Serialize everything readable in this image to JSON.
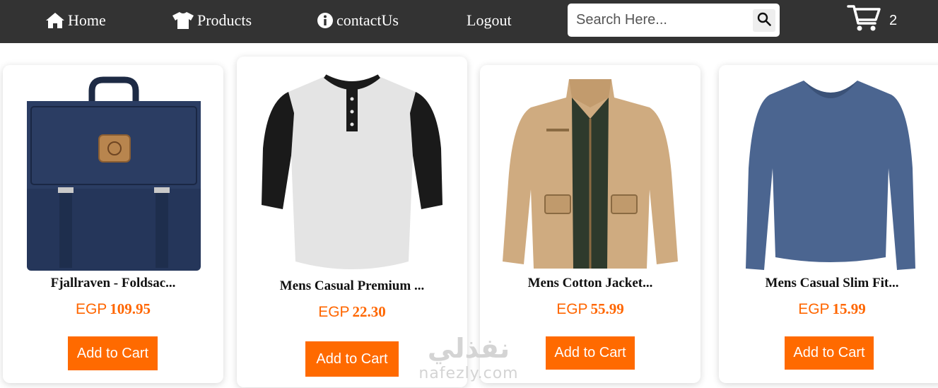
{
  "nav": {
    "home_label": "Home",
    "products_label": "Products",
    "contact_label": "contactUs",
    "logout_label": "Logout",
    "search_placeholder": "Search Here...",
    "cart_count": "2",
    "icons": [
      "home-icon",
      "shirt-icon",
      "info-icon",
      "search-icon",
      "cart-icon"
    ]
  },
  "products": [
    {
      "title": "Fjallraven - Foldsac...",
      "currency": "EGP",
      "price": "109.95",
      "button_label": "Add to Cart",
      "image": "backpack"
    },
    {
      "title": "Mens Casual Premium ...",
      "currency": "EGP",
      "price": "22.30",
      "button_label": "Add to Cart",
      "image": "henley-shirt"
    },
    {
      "title": "Mens Cotton Jacket...",
      "currency": "EGP",
      "price": "55.99",
      "button_label": "Add to Cart",
      "image": "cotton-jacket"
    },
    {
      "title": "Mens Casual Slim Fit...",
      "currency": "EGP",
      "price": "15.99",
      "button_label": "Add to Cart",
      "image": "slim-fit-tshirt"
    }
  ],
  "watermark": {
    "arabic": "نفذلي",
    "latin": "nafezly.com"
  },
  "colors": {
    "navbar": "#333333",
    "accent": "#ff6a00",
    "price": "#ff6600",
    "background": "#ffffff"
  }
}
